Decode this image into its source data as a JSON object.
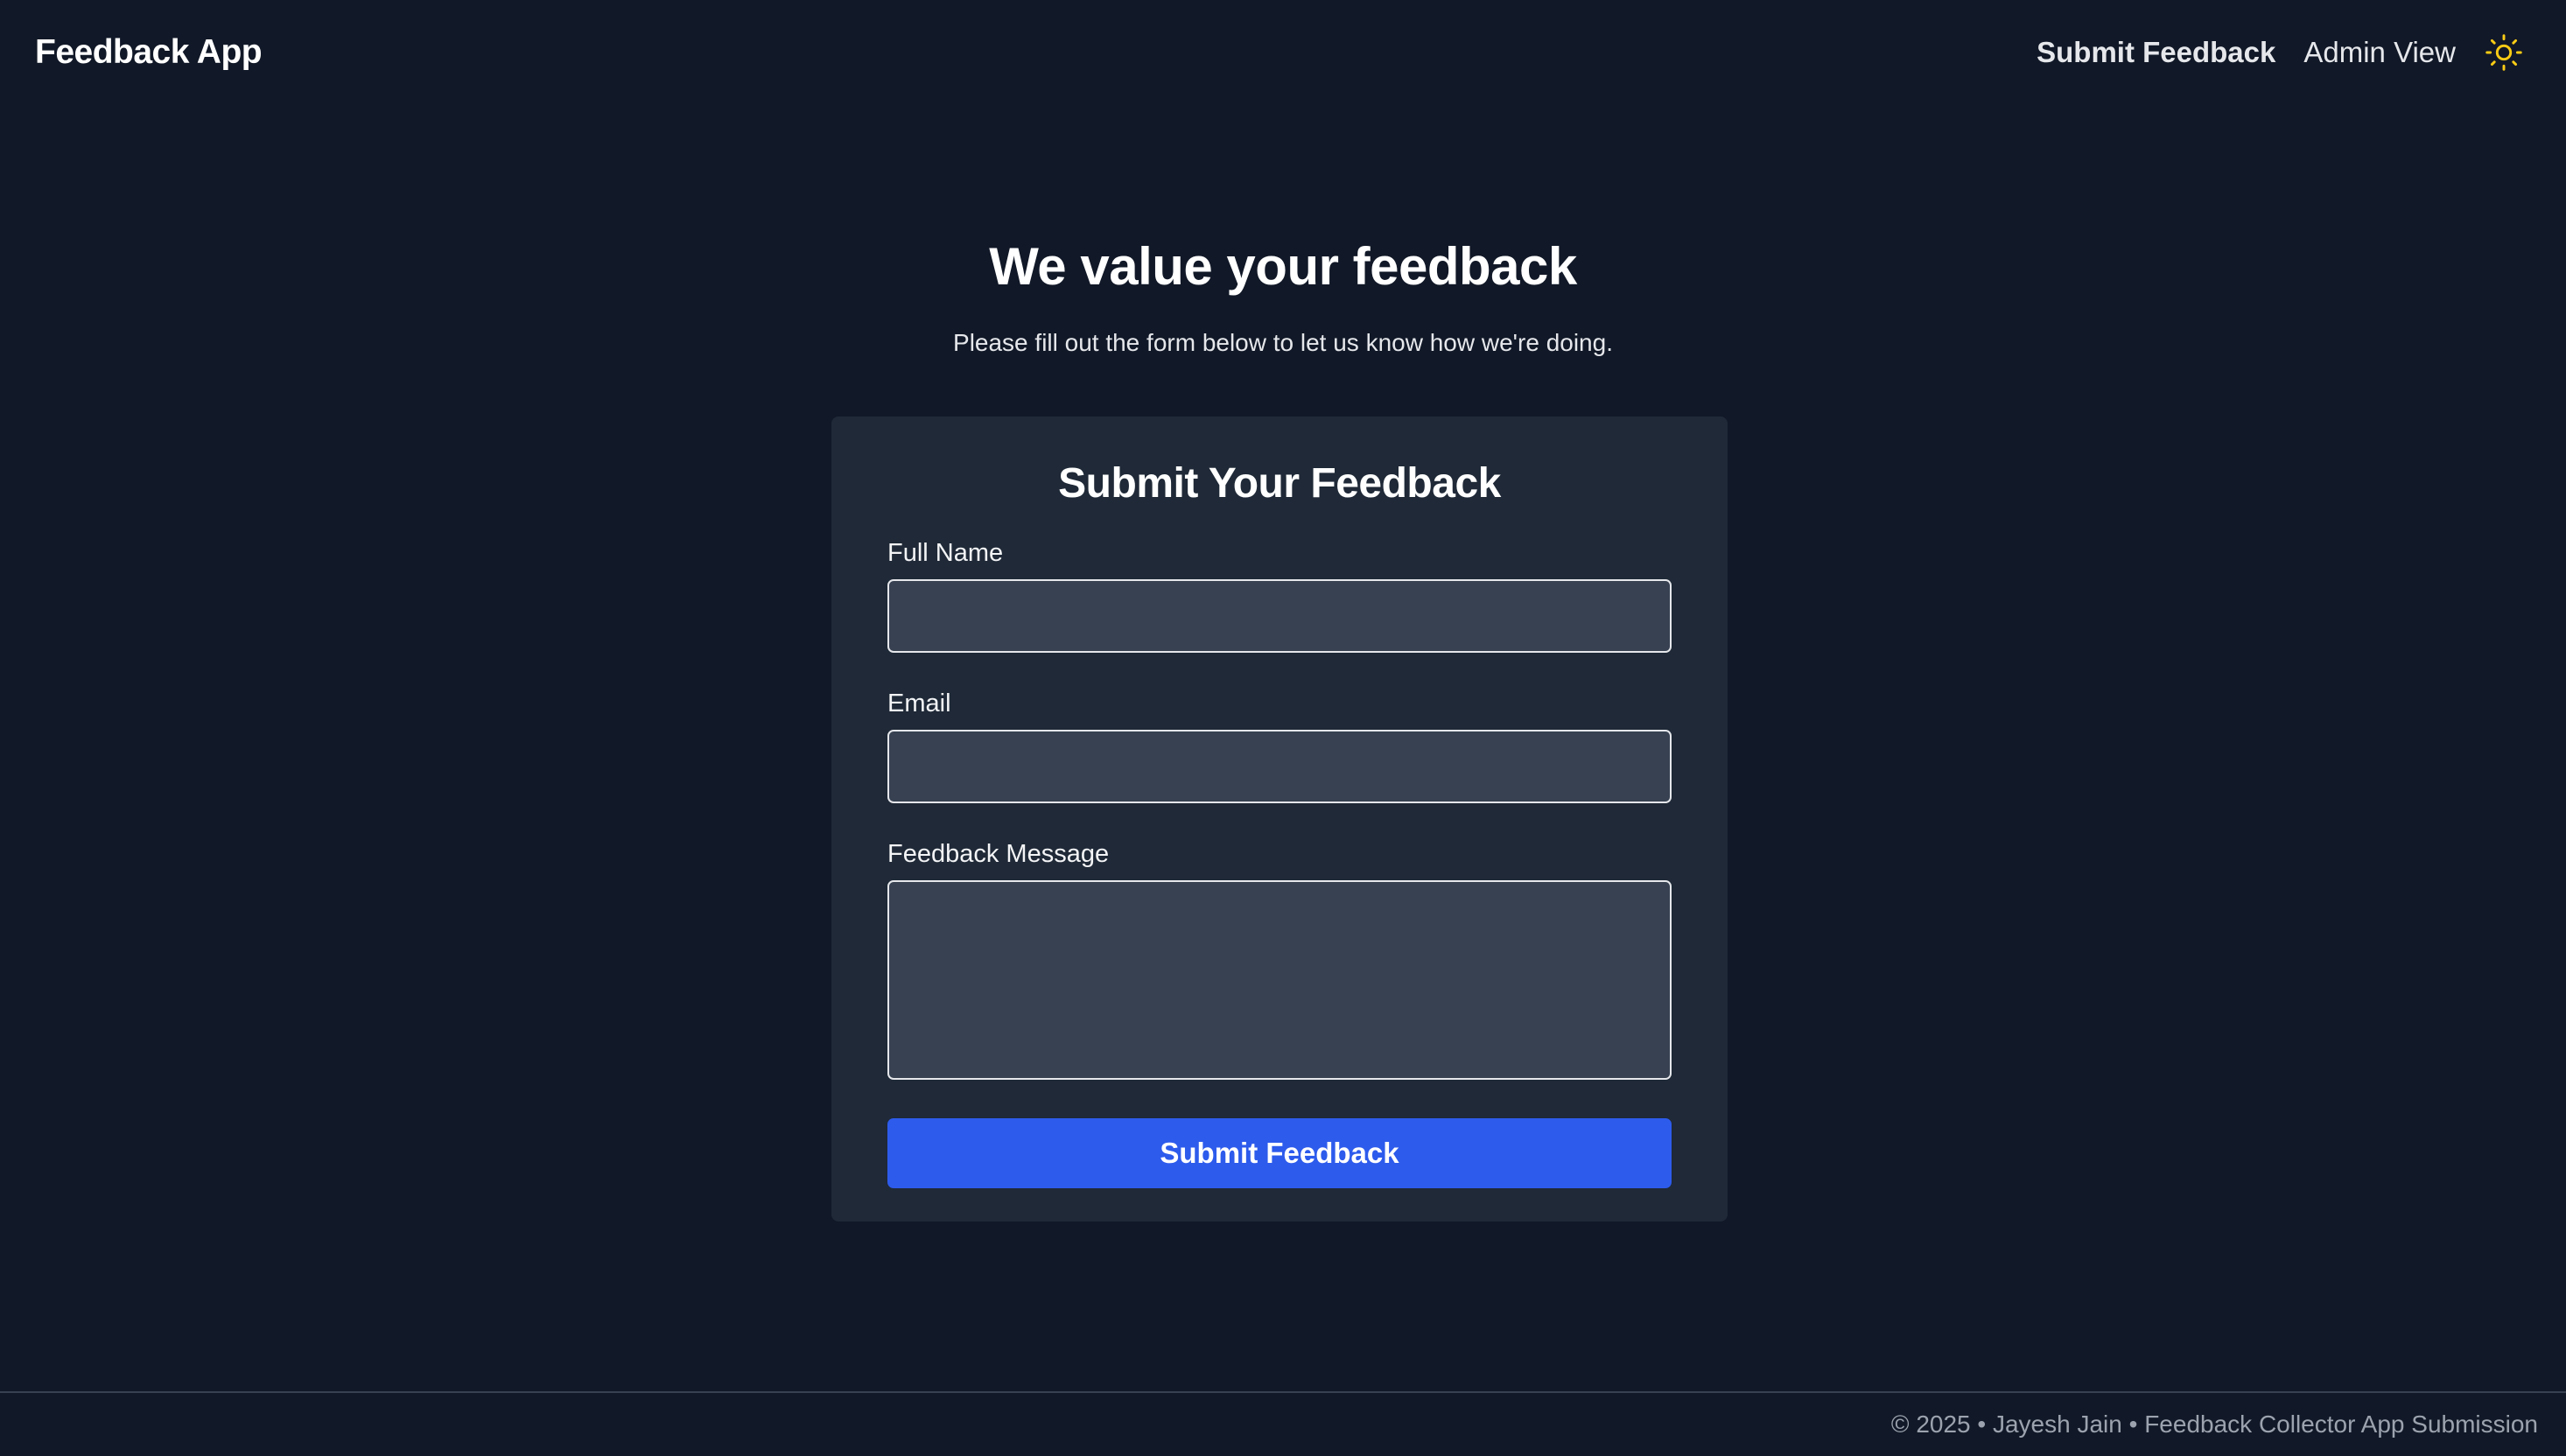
{
  "navbar": {
    "brand": "Feedback App",
    "links": [
      {
        "label": "Submit Feedback",
        "active": true
      },
      {
        "label": "Admin View",
        "active": false
      }
    ],
    "theme_toggle_icon": "sun-icon",
    "theme_icon_color": "#facc15"
  },
  "hero": {
    "title": "We value your feedback",
    "subtitle": "Please fill out the form below to let us know how we're doing."
  },
  "form": {
    "title": "Submit Your Feedback",
    "fields": {
      "full_name": {
        "label": "Full Name",
        "value": "",
        "placeholder": ""
      },
      "email": {
        "label": "Email",
        "value": "",
        "placeholder": ""
      },
      "message": {
        "label": "Feedback Message",
        "value": "",
        "placeholder": ""
      }
    },
    "submit_label": "Submit Feedback",
    "submit_color": "#2d5bec"
  },
  "footer": {
    "text": "© 2025 • Jayesh Jain • Feedback Collector App Submission"
  },
  "colors": {
    "background": "#111827",
    "card": "#1f2937",
    "input_bg": "#374151"
  }
}
